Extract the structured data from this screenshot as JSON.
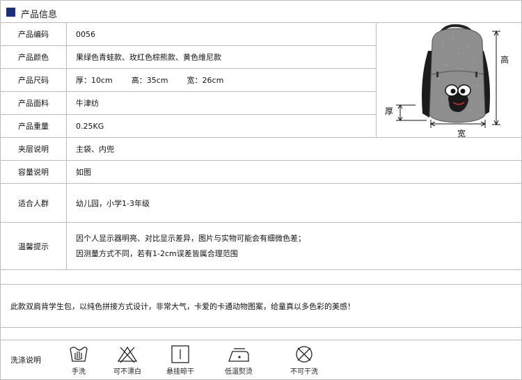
{
  "header": {
    "title": "产品信息"
  },
  "rows": [
    {
      "label": "产品编码",
      "value": "0056"
    },
    {
      "label": "产品颜色",
      "value": "果绿色青蛙款、玫红色棕熊款、黄色维尼款"
    },
    {
      "label": "产品尺码",
      "thickness": "厚：10cm",
      "height": "高：35cm",
      "width": "宽：26cm"
    },
    {
      "label": "产品面料",
      "value": "牛津纺"
    },
    {
      "label": "产品重量",
      "value": "0.25KG"
    },
    {
      "label": "夹层说明",
      "value": "主袋、内兜"
    },
    {
      "label": "容量说明",
      "value": "如图"
    },
    {
      "label": "适合人群",
      "value": "幼儿园，小学1-3年级"
    },
    {
      "label": "温馨提示",
      "line1": "因个人显示器明亮、对比显示差异，图片与实物可能会有细微色差；",
      "line2": "因测量方式不同，若有1-2cm误差皆属合理范围"
    }
  ],
  "diagram": {
    "height_label": "高",
    "width_label": "宽",
    "thickness_label": "厚"
  },
  "description": "此款双肩背学生包，以纯色拼接方式设计，非常大气，卡爱的卡通动物图案，给童真以多色彩的美感！",
  "washing": {
    "label": "洗涤说明",
    "items": [
      {
        "label": "手洗",
        "icon": "hand-wash-icon"
      },
      {
        "label": "可不漂白",
        "icon": "no-bleach-icon"
      },
      {
        "label": "悬挂晾干",
        "icon": "hang-dry-icon"
      },
      {
        "label": "低温熨烫",
        "icon": "low-iron-icon"
      },
      {
        "label": "不可干洗",
        "icon": "no-dry-clean-icon"
      }
    ]
  }
}
